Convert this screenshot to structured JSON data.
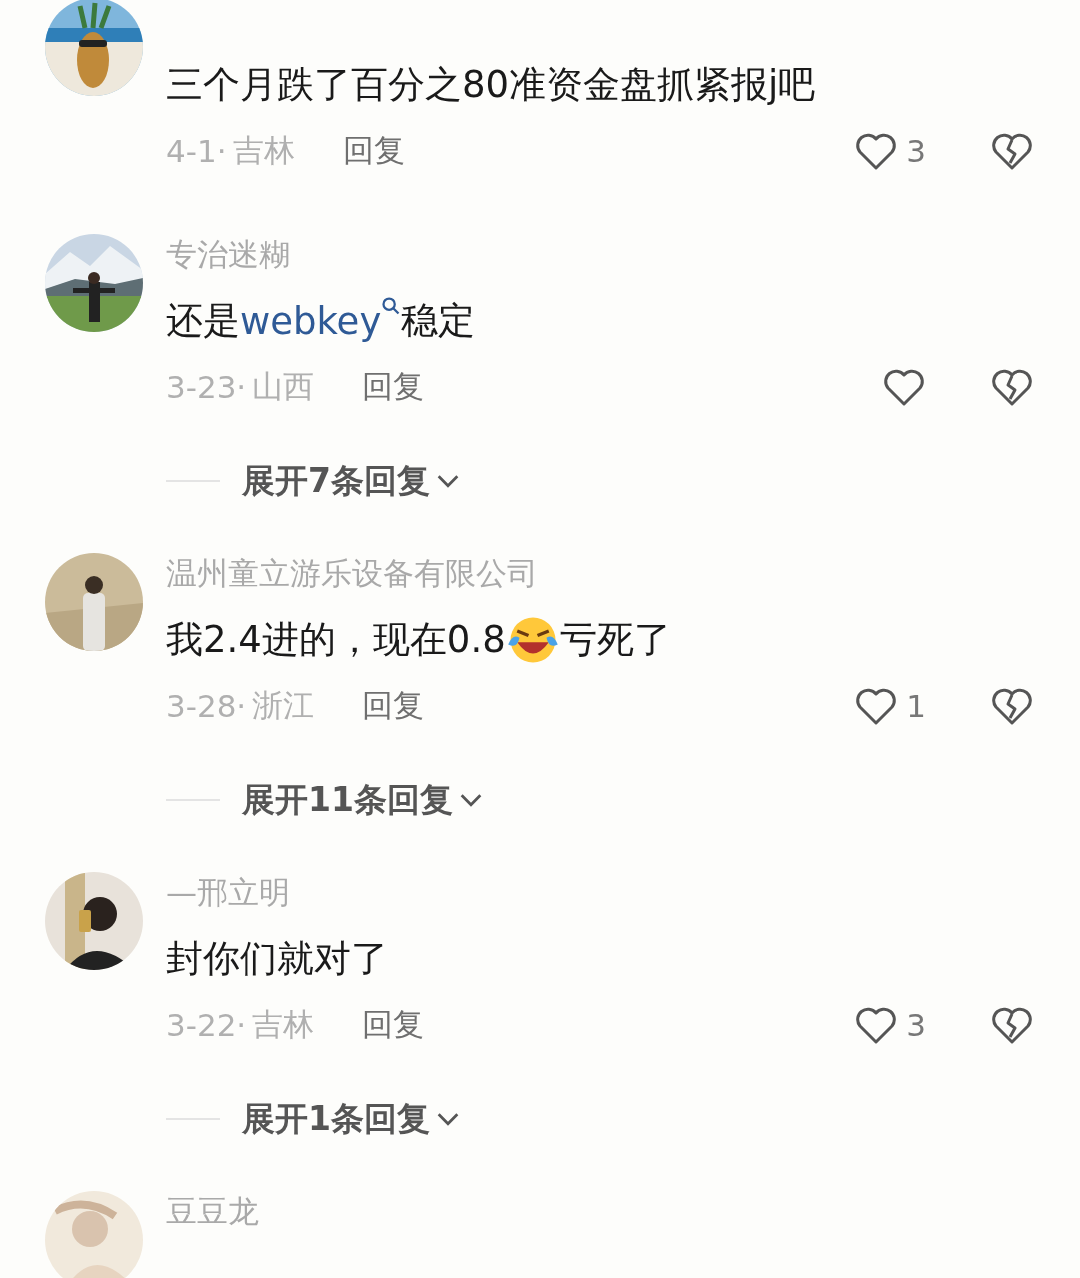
{
  "comments": [
    {
      "text": [
        {
          "kind": "text",
          "value": "三个月跌了百分之80准资金盘抓紧报j吧"
        }
      ],
      "date": "4-1·",
      "location": "吉林",
      "reply": "回复",
      "likes": "3"
    },
    {
      "name": "专治迷糊",
      "text": [
        {
          "kind": "text",
          "value": "还是"
        },
        {
          "kind": "link",
          "value": "webkey"
        },
        {
          "kind": "text",
          "value": "稳定"
        }
      ],
      "date": "3-23·",
      "location": "山西",
      "reply": "回复",
      "expand": "展开7条回复"
    },
    {
      "name": "温州童立游乐设备有限公司",
      "text": [
        {
          "kind": "text",
          "value": "我2.4进的，现在0.8"
        },
        {
          "kind": "emoji"
        },
        {
          "kind": "text",
          "value": "亏死了"
        }
      ],
      "date": "3-28·",
      "location": "浙江",
      "reply": "回复",
      "likes": "1",
      "expand": "展开11条回复"
    },
    {
      "name": "—邢立明",
      "text": [
        {
          "kind": "text",
          "value": "封你们就对了"
        }
      ],
      "date": "3-22·",
      "location": "吉林",
      "reply": "回复",
      "likes": "3",
      "expand": "展开1条回复"
    },
    {
      "name": "豆豆龙"
    }
  ]
}
